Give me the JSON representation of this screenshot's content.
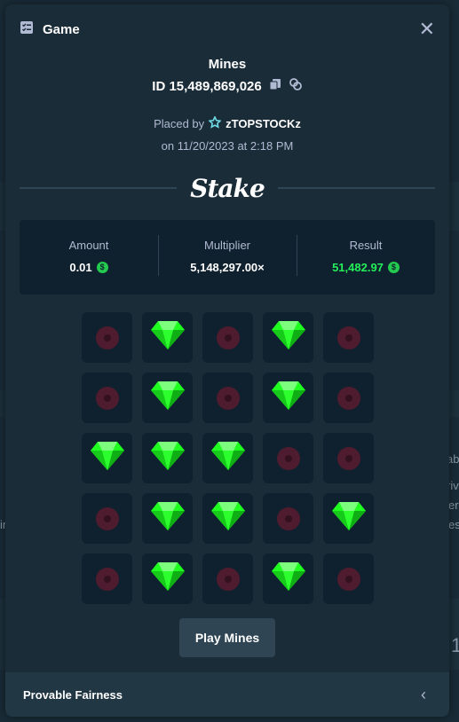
{
  "modal": {
    "title": "Game",
    "game_name": "Mines",
    "bet_id": "ID 15,489,869,026",
    "placed_by_label": "Placed by",
    "username": "zTOPSTOCKz",
    "date": "on 11/20/2023 at 2:18 PM",
    "logo": "Stake"
  },
  "stats": {
    "amount_label": "Amount",
    "amount_value": "0.01",
    "multiplier_label": "Multiplier",
    "multiplier_value": "5,148,297.00×",
    "result_label": "Result",
    "result_value": "51,482.97"
  },
  "grid": [
    "mine",
    "gem",
    "mine",
    "gem",
    "mine",
    "mine",
    "gem",
    "mine",
    "gem",
    "mine",
    "gem",
    "gem",
    "gem",
    "mine",
    "mine",
    "mine",
    "gem",
    "gem",
    "mine",
    "gem",
    "mine",
    "gem",
    "mine",
    "gem",
    "mine"
  ],
  "play_button_label": "Play Mines",
  "footer": {
    "label": "Provable Fairness"
  },
  "background_text": {
    "a": "ab",
    "b": "riv",
    "c": "er",
    "d": "es",
    "e": "ir",
    "f": "1"
  },
  "colors": {
    "accent_green": "#24ee5a",
    "gem": "#1fff20",
    "mine": "#5b1a2e"
  }
}
